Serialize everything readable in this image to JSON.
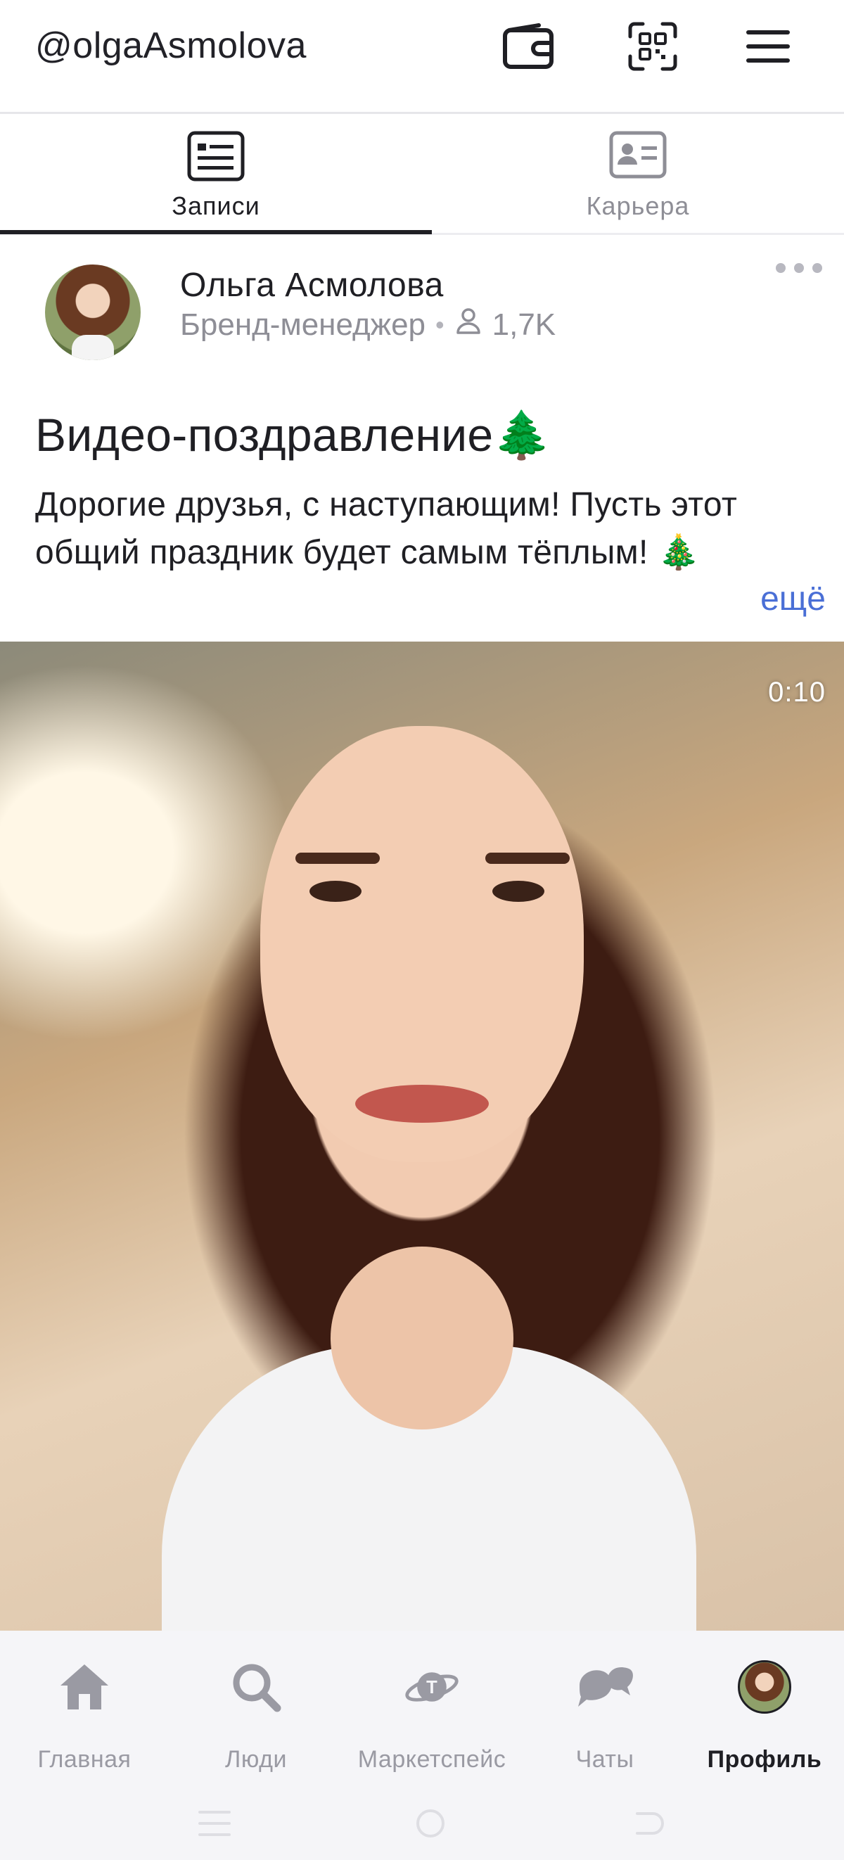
{
  "topbar": {
    "handle": "@olgaAsmolova",
    "icons": [
      "wallet-icon",
      "qr-scan-icon",
      "menu-icon"
    ]
  },
  "tabs": [
    {
      "label": "Записи",
      "icon": "posts-icon",
      "active": true
    },
    {
      "label": "Карьера",
      "icon": "id-card-icon",
      "active": false
    }
  ],
  "post": {
    "author": "Ольга Асмолова",
    "role": "Бренд-менеджер",
    "followers": "1,7K",
    "title": "Видео-поздравление🌲",
    "text": "Дорогие друзья, с наступающим! Пусть этот общий праздник будет самым тёплым! 🎄",
    "more_label": "ещё",
    "video_duration": "0:10"
  },
  "bottom_nav": [
    {
      "label": "Главная",
      "icon": "home-icon",
      "active": false
    },
    {
      "label": "Люди",
      "icon": "search-icon",
      "active": false
    },
    {
      "label": "Маркетспейс",
      "icon": "planet-icon",
      "active": false
    },
    {
      "label": "Чаты",
      "icon": "chat-icon",
      "active": false
    },
    {
      "label": "Профиль",
      "icon": "avatar",
      "active": true
    }
  ],
  "colors": {
    "accent_link": "#4a6fd6",
    "text_primary": "#1f1f24",
    "text_secondary": "#8e8e96",
    "nav_background": "#f5f5f8"
  }
}
